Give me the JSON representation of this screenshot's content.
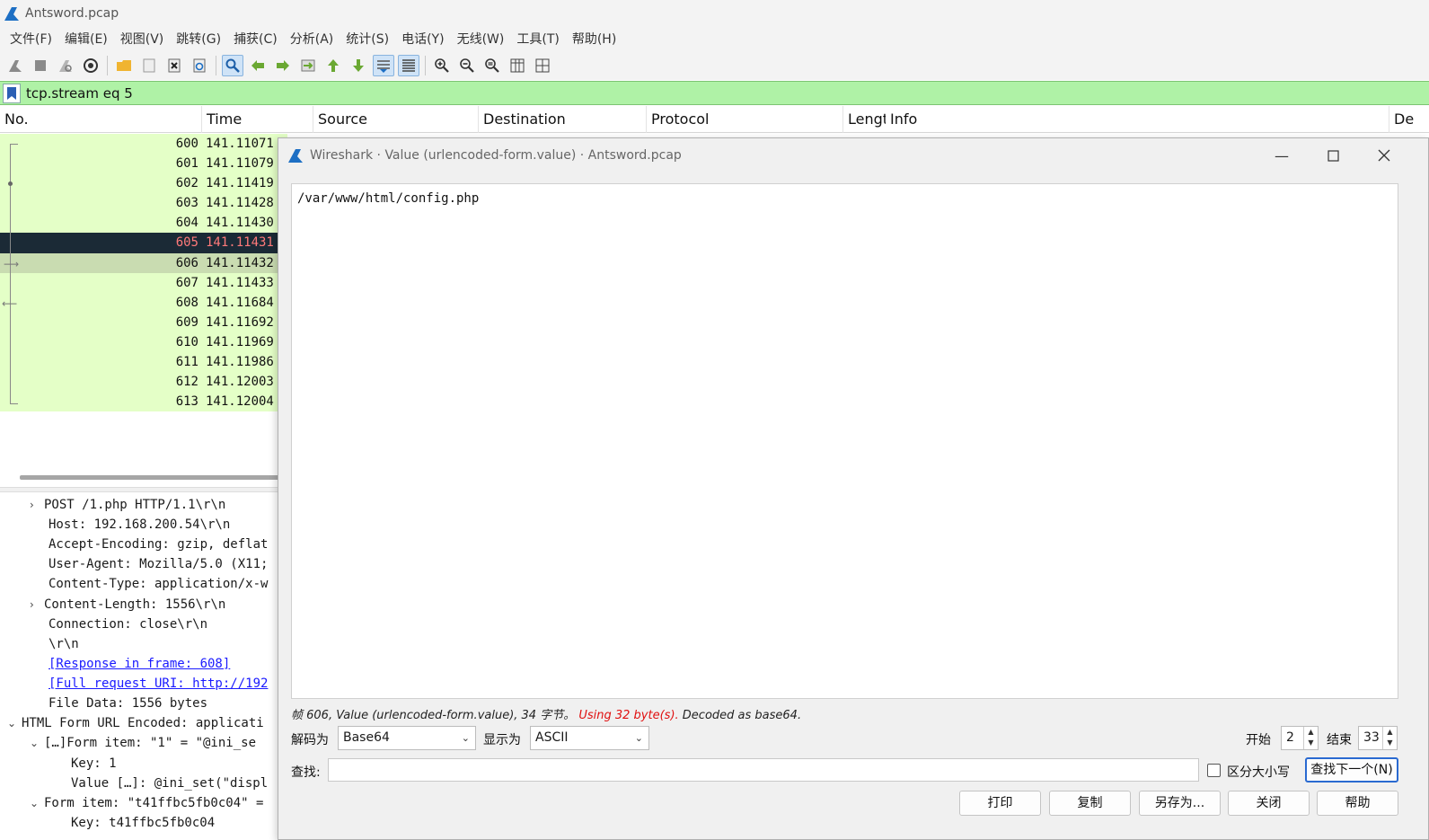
{
  "app": {
    "title": "Antsword.pcap"
  },
  "menu": [
    "文件(F)",
    "编辑(E)",
    "视图(V)",
    "跳转(G)",
    "捕获(C)",
    "分析(A)",
    "统计(S)",
    "电话(Y)",
    "无线(W)",
    "工具(T)",
    "帮助(H)"
  ],
  "filter": {
    "value": "tcp.stream eq 5"
  },
  "columns": [
    "No.",
    "Time",
    "Source",
    "Destination",
    "Protocol",
    "Lengt",
    "Info",
    "De"
  ],
  "packets": [
    {
      "no": "600",
      "time": "141.11071"
    },
    {
      "no": "601",
      "time": "141.11079"
    },
    {
      "no": "602",
      "time": "141.11419"
    },
    {
      "no": "603",
      "time": "141.11428"
    },
    {
      "no": "604",
      "time": "141.11430"
    },
    {
      "no": "605",
      "time": "141.11431"
    },
    {
      "no": "606",
      "time": "141.11432"
    },
    {
      "no": "607",
      "time": "141.11433"
    },
    {
      "no": "608",
      "time": "141.11684"
    },
    {
      "no": "609",
      "time": "141.11692"
    },
    {
      "no": "610",
      "time": "141.11969"
    },
    {
      "no": "611",
      "time": "141.11986"
    },
    {
      "no": "612",
      "time": "141.12003"
    },
    {
      "no": "613",
      "time": "141.12004"
    }
  ],
  "detail_lines": [
    "POST /1.php HTTP/1.1\\r\\n",
    "Host: 192.168.200.54\\r\\n",
    "Accept-Encoding: gzip, deflat",
    "User-Agent: Mozilla/5.0 (X11;",
    "Content-Type: application/x-w",
    "Content-Length: 1556\\r\\n",
    "Connection: close\\r\\n",
    "\\r\\n",
    "[Response in frame: 608]",
    "[Full request URI: http://192",
    "File Data: 1556 bytes",
    "HTML Form URL Encoded: applicati",
    "[…]Form item: \"1\" = \"@ini_se",
    "Key: 1",
    "Value […]: @ini_set(\"displ",
    "Form item: \"t41ffbc5fb0c04\" =",
    "Key: t41ffbc5fb0c04"
  ],
  "dialog": {
    "title": "Wireshark · Value (urlencoded-form.value) · Antsword.pcap",
    "content": "/var/www/html/config.php",
    "status_prefix": "帧 606, Value (urlencoded-form.value), 34 字节。",
    "status_warning": "Using 32 byte(s).",
    "status_suffix": "Decoded as base64.",
    "decode_label": "解码为",
    "decode_value": "Base64",
    "show_label": "显示为",
    "show_value": "ASCII",
    "start_label": "开始",
    "start_value": "2",
    "end_label": "结束",
    "end_value": "33",
    "find_label": "查找:",
    "find_value": "",
    "case_label": "区分大小写",
    "find_next": "查找下一个(N)",
    "buttons": {
      "print": "打印",
      "copy": "复制",
      "save_as": "另存为...",
      "close": "关闭",
      "help": "帮助"
    }
  },
  "colors": {
    "row_bg": "#e4ffc7",
    "selected_dark": "#1b2a36",
    "filter_bg": "#aff2a6",
    "warning": "#e01010"
  }
}
